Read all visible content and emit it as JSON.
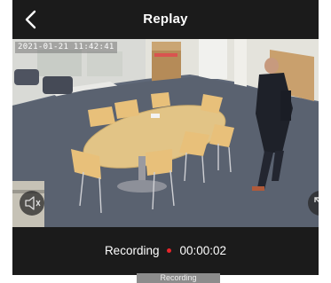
{
  "header": {
    "title": "Replay",
    "back_icon": "chevron-left-icon"
  },
  "video": {
    "timestamp": "2021-01-21 11:42:41",
    "volume_icon": "speaker-muted-icon",
    "fullscreen_icon": "fullscreen-icon"
  },
  "status": {
    "label": "Recording",
    "elapsed": "00:00:02",
    "dot_color": "#e8262b"
  },
  "toast": {
    "text": "Recording"
  }
}
